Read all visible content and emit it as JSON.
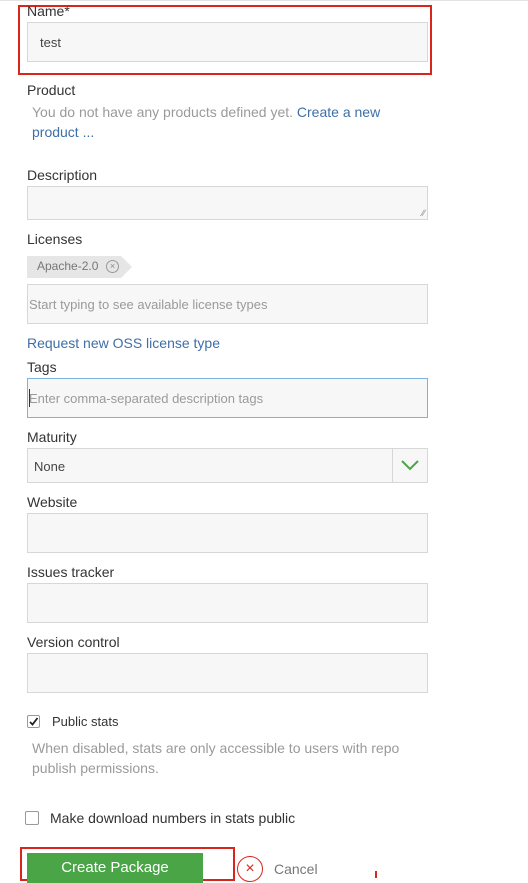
{
  "form": {
    "name": {
      "label": "Name*",
      "value": "test"
    },
    "product": {
      "label": "Product",
      "empty_text": "You do not have any products defined yet.",
      "create_link_line1": "Create a new",
      "create_link_line2": "product ..."
    },
    "description": {
      "label": "Description",
      "value": ""
    },
    "licenses": {
      "label": "Licenses",
      "selected_tag": "Apache-2.0",
      "placeholder": "Start typing to see available license types",
      "request_link": "Request new OSS license type"
    },
    "tags": {
      "label": "Tags",
      "placeholder": "Enter comma-separated description tags"
    },
    "maturity": {
      "label": "Maturity",
      "selected": "None"
    },
    "website": {
      "label": "Website",
      "value": ""
    },
    "issues_tracker": {
      "label": "Issues tracker",
      "value": ""
    },
    "version_control": {
      "label": "Version control",
      "value": ""
    },
    "public_stats": {
      "label": "Public stats",
      "checked": true,
      "help_line1": "When disabled, stats are only accessible to users with repo",
      "help_line2": "publish permissions."
    },
    "download_numbers": {
      "label": "Make download numbers in stats public",
      "checked": false
    }
  },
  "actions": {
    "create_label": "Create Package",
    "cancel_label": "Cancel"
  },
  "colors": {
    "accent_green": "#4aa547",
    "highlight_red": "#d9261c",
    "link_blue": "#3d6fa8",
    "focus_blue": "#7fb1e0"
  }
}
